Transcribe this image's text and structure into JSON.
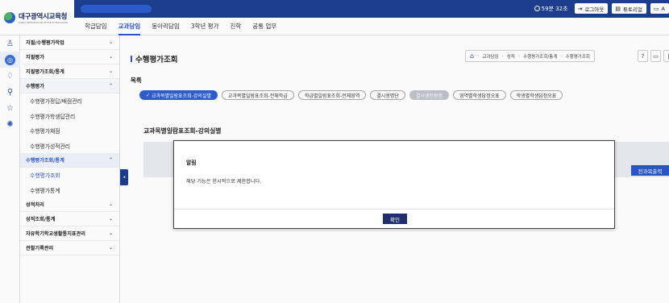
{
  "header": {
    "logo_text": "대구광역시교육청",
    "logo_sub": "DAEGU METROPOLITAN OFFICE OF EDUCATION",
    "timer": "59분 32초",
    "buttons": [
      {
        "icon": "logout-icon",
        "label": "로그아웃"
      },
      {
        "icon": "tutorial-icon",
        "label": "튜토리얼"
      },
      {
        "icon": "monitor-icon",
        "label": "A"
      }
    ]
  },
  "menu": {
    "items": [
      "학급담임",
      "교과담임",
      "동아리담임",
      "3학년 평가",
      "진학",
      "공통 업무"
    ],
    "active_index": 1
  },
  "sidebar": {
    "groups": [
      {
        "label": "지필/수행평가작업",
        "state": "closed"
      },
      {
        "label": "지필평가",
        "state": "closed"
      },
      {
        "label": "지필평가조회/통계",
        "state": "closed"
      },
      {
        "label": "수행평가",
        "state": "open",
        "items": [
          "수행평가정답/배점관리",
          "수행평가학생답관리",
          "수행평가채점",
          "수행평가성적관리"
        ]
      },
      {
        "label": "수행평가조회/통계",
        "state": "open-highlight",
        "items": [
          "수행평가조회",
          "수행평가통계"
        ]
      },
      {
        "label": "성적처리",
        "state": "closed"
      },
      {
        "label": "성적조회/통계",
        "state": "closed"
      },
      {
        "label": "자유학기학교생활통지표관리",
        "state": "closed"
      },
      {
        "label": "관찰기록관리",
        "state": "closed"
      }
    ]
  },
  "page": {
    "title": "수행평가조회",
    "breadcrumb": [
      "교과담임",
      "성적",
      "수행평가조회/통계",
      "수행평가조회"
    ],
    "list_label": "목록",
    "tabs": [
      {
        "label": "교과목별일람표조회-강의실별",
        "state": "active"
      },
      {
        "label": "교과목별일람표조회-전체학급",
        "state": "normal"
      },
      {
        "label": "학급별일람표조회-전체영역",
        "state": "normal"
      },
      {
        "label": "결시생명단",
        "state": "normal"
      },
      {
        "label": "결시생인원점",
        "state": "disabled"
      },
      {
        "label": "영역별학생답정오표",
        "state": "normal"
      },
      {
        "label": "학생별학생답정오표",
        "state": "normal"
      }
    ],
    "section_title": "교과목별일람표조회-강의실별",
    "print_all": "전과목출력"
  },
  "modal": {
    "title": "알림",
    "message": "해당 기능은 한시적으로 제한합니다.",
    "ok": "확인"
  }
}
